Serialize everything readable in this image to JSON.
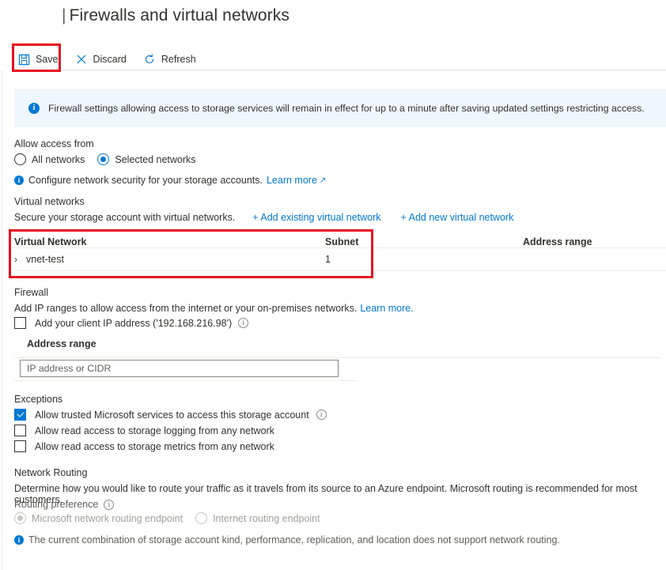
{
  "header": {
    "separator_glyph": "|",
    "title": "Firewalls and virtual networks"
  },
  "toolbar": {
    "save_label": "Save",
    "discard_label": "Discard",
    "refresh_label": "Refresh",
    "save_icon": "save-floppy-icon",
    "discard_icon": "close-x-icon",
    "refresh_icon": "refresh-circular-arrow-icon"
  },
  "banner": {
    "icon": "info-filled-icon",
    "message": "Firewall settings allowing access to storage services will remain in effect for up to a minute after saving updated settings restricting access.",
    "background": "#f0f6fd",
    "accent": "#0078d4"
  },
  "allow_access": {
    "title": "Allow access from",
    "options": [
      {
        "label": "All networks",
        "selected": false
      },
      {
        "label": "Selected networks",
        "selected": true
      }
    ],
    "note": "Configure network security for your storage accounts.",
    "note_link": "Learn more",
    "note_link_icon": "external-link-icon"
  },
  "virtual_networks": {
    "title": "Virtual networks",
    "description": "Secure your storage account with virtual networks.",
    "add_existing_label": "+ Add existing virtual network",
    "add_new_label": "+ Add new virtual network",
    "columns": [
      "Virtual Network",
      "Subnet",
      "Address range"
    ],
    "rows": [
      {
        "name": "vnet-test",
        "subnet": "1",
        "address_range": "",
        "expander_icon": "chevron-right-icon"
      }
    ]
  },
  "firewall": {
    "title": "Firewall",
    "description": "Add IP ranges to allow access from the internet or your on-premises networks.",
    "description_link": "Learn more.",
    "client_ip_checkbox": {
      "label": "Add your client IP address ('192.168.216.98')",
      "checked": false,
      "info_icon": "info-outline-icon"
    },
    "address_range_label": "Address range",
    "address_range_value": "",
    "address_range_placeholder": "IP address or CIDR"
  },
  "exceptions": {
    "title": "Exceptions",
    "items": [
      {
        "label": "Allow trusted Microsoft services to access this storage account",
        "checked": true,
        "info_icon": "info-outline-icon"
      },
      {
        "label": "Allow read access to storage logging from any network",
        "checked": false,
        "info_icon": ""
      },
      {
        "label": "Allow read access to storage metrics from any network",
        "checked": false,
        "info_icon": ""
      }
    ]
  },
  "network_routing": {
    "title": "Network Routing",
    "description": "Determine how you would like to route your traffic as it travels from its source to an Azure endpoint. Microsoft routing is recommended for most customers.",
    "preference_label": "Routing preference",
    "preference_info_icon": "info-outline-icon",
    "options": [
      {
        "label": "Microsoft network routing endpoint",
        "selected": true,
        "disabled": true
      },
      {
        "label": "Internet routing endpoint",
        "selected": false,
        "disabled": true
      }
    ],
    "note_icon": "info-filled-icon",
    "note": "The current combination of storage account kind, performance, replication, and location does not support network routing."
  },
  "highlights": {
    "color": "#e81123",
    "regions": [
      "save-button",
      "virtual-network-table"
    ]
  }
}
